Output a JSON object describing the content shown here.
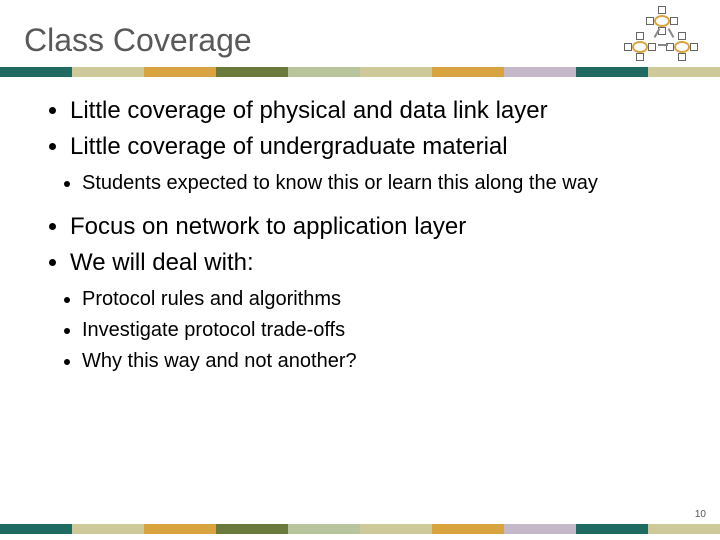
{
  "title": "Class Coverage",
  "bullets": {
    "b1": "Little coverage of physical and data link layer",
    "b2": "Little coverage of undergraduate material",
    "b2_1": "Students expected to know this or learn this along the way",
    "b3": "Focus on network to application layer",
    "b4": "We will deal with:",
    "b4_1": "Protocol rules and algorithms",
    "b4_2": "Investigate protocol trade-offs",
    "b4_3": "Why this way and not another?"
  },
  "page_number": "10",
  "stripe_colors": [
    "#1f6b62",
    "#cdc999",
    "#d9a33f",
    "#6a7a3d",
    "#b7c49c",
    "#cdc999",
    "#d9a33f",
    "#c4b8c9",
    "#1f6b62",
    "#cdc999"
  ]
}
